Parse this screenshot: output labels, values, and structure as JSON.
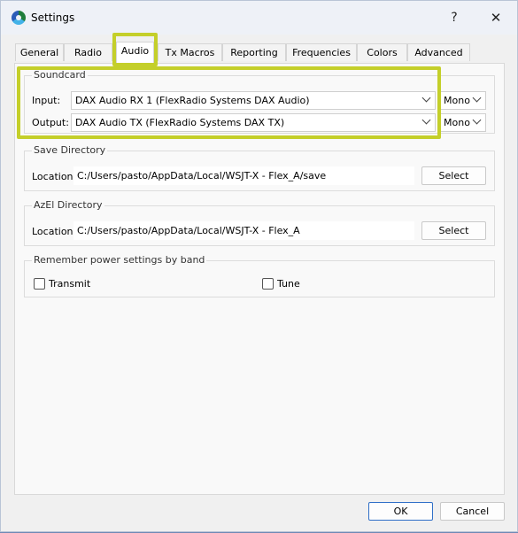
{
  "window": {
    "title": "Settings",
    "help_symbol": "?",
    "close_symbol": "✕"
  },
  "tabs": [
    {
      "label": "General"
    },
    {
      "label": "Radio"
    },
    {
      "label": "Audio"
    },
    {
      "label": "Tx Macros"
    },
    {
      "label": "Reporting"
    },
    {
      "label": "Frequencies"
    },
    {
      "label": "Colors"
    },
    {
      "label": "Advanced"
    }
  ],
  "active_tab": "Audio",
  "soundcard": {
    "title": "Soundcard",
    "input_label": "Input:",
    "input_value": "DAX Audio RX 1 (FlexRadio Systems DAX Audio)",
    "input_channel": "Mono",
    "output_label": "Output:",
    "output_value": "DAX Audio TX (FlexRadio Systems DAX TX)",
    "output_channel": "Mono"
  },
  "save_directory": {
    "title": "Save Directory",
    "location_label": "Location:",
    "location_value": "C:/Users/pasto/AppData/Local/WSJT-X - Flex_A/save",
    "select_label": "Select"
  },
  "azel_directory": {
    "title": "AzEl Directory",
    "location_label": "Location:",
    "location_value": "C:/Users/pasto/AppData/Local/WSJT-X - Flex_A",
    "select_label": "Select"
  },
  "power_settings": {
    "title": "Remember power settings by band",
    "transmit_label": "Transmit",
    "transmit_checked": false,
    "tune_label": "Tune",
    "tune_checked": false
  },
  "footer": {
    "ok_label": "OK",
    "cancel_label": "Cancel"
  },
  "colors": {
    "highlight": "#c4cf2a",
    "ok_border": "#2f6fc7"
  },
  "icons": {
    "app": "wsjtx-app-icon",
    "close": "close-icon",
    "dropdown": "chevron-down-icon"
  }
}
